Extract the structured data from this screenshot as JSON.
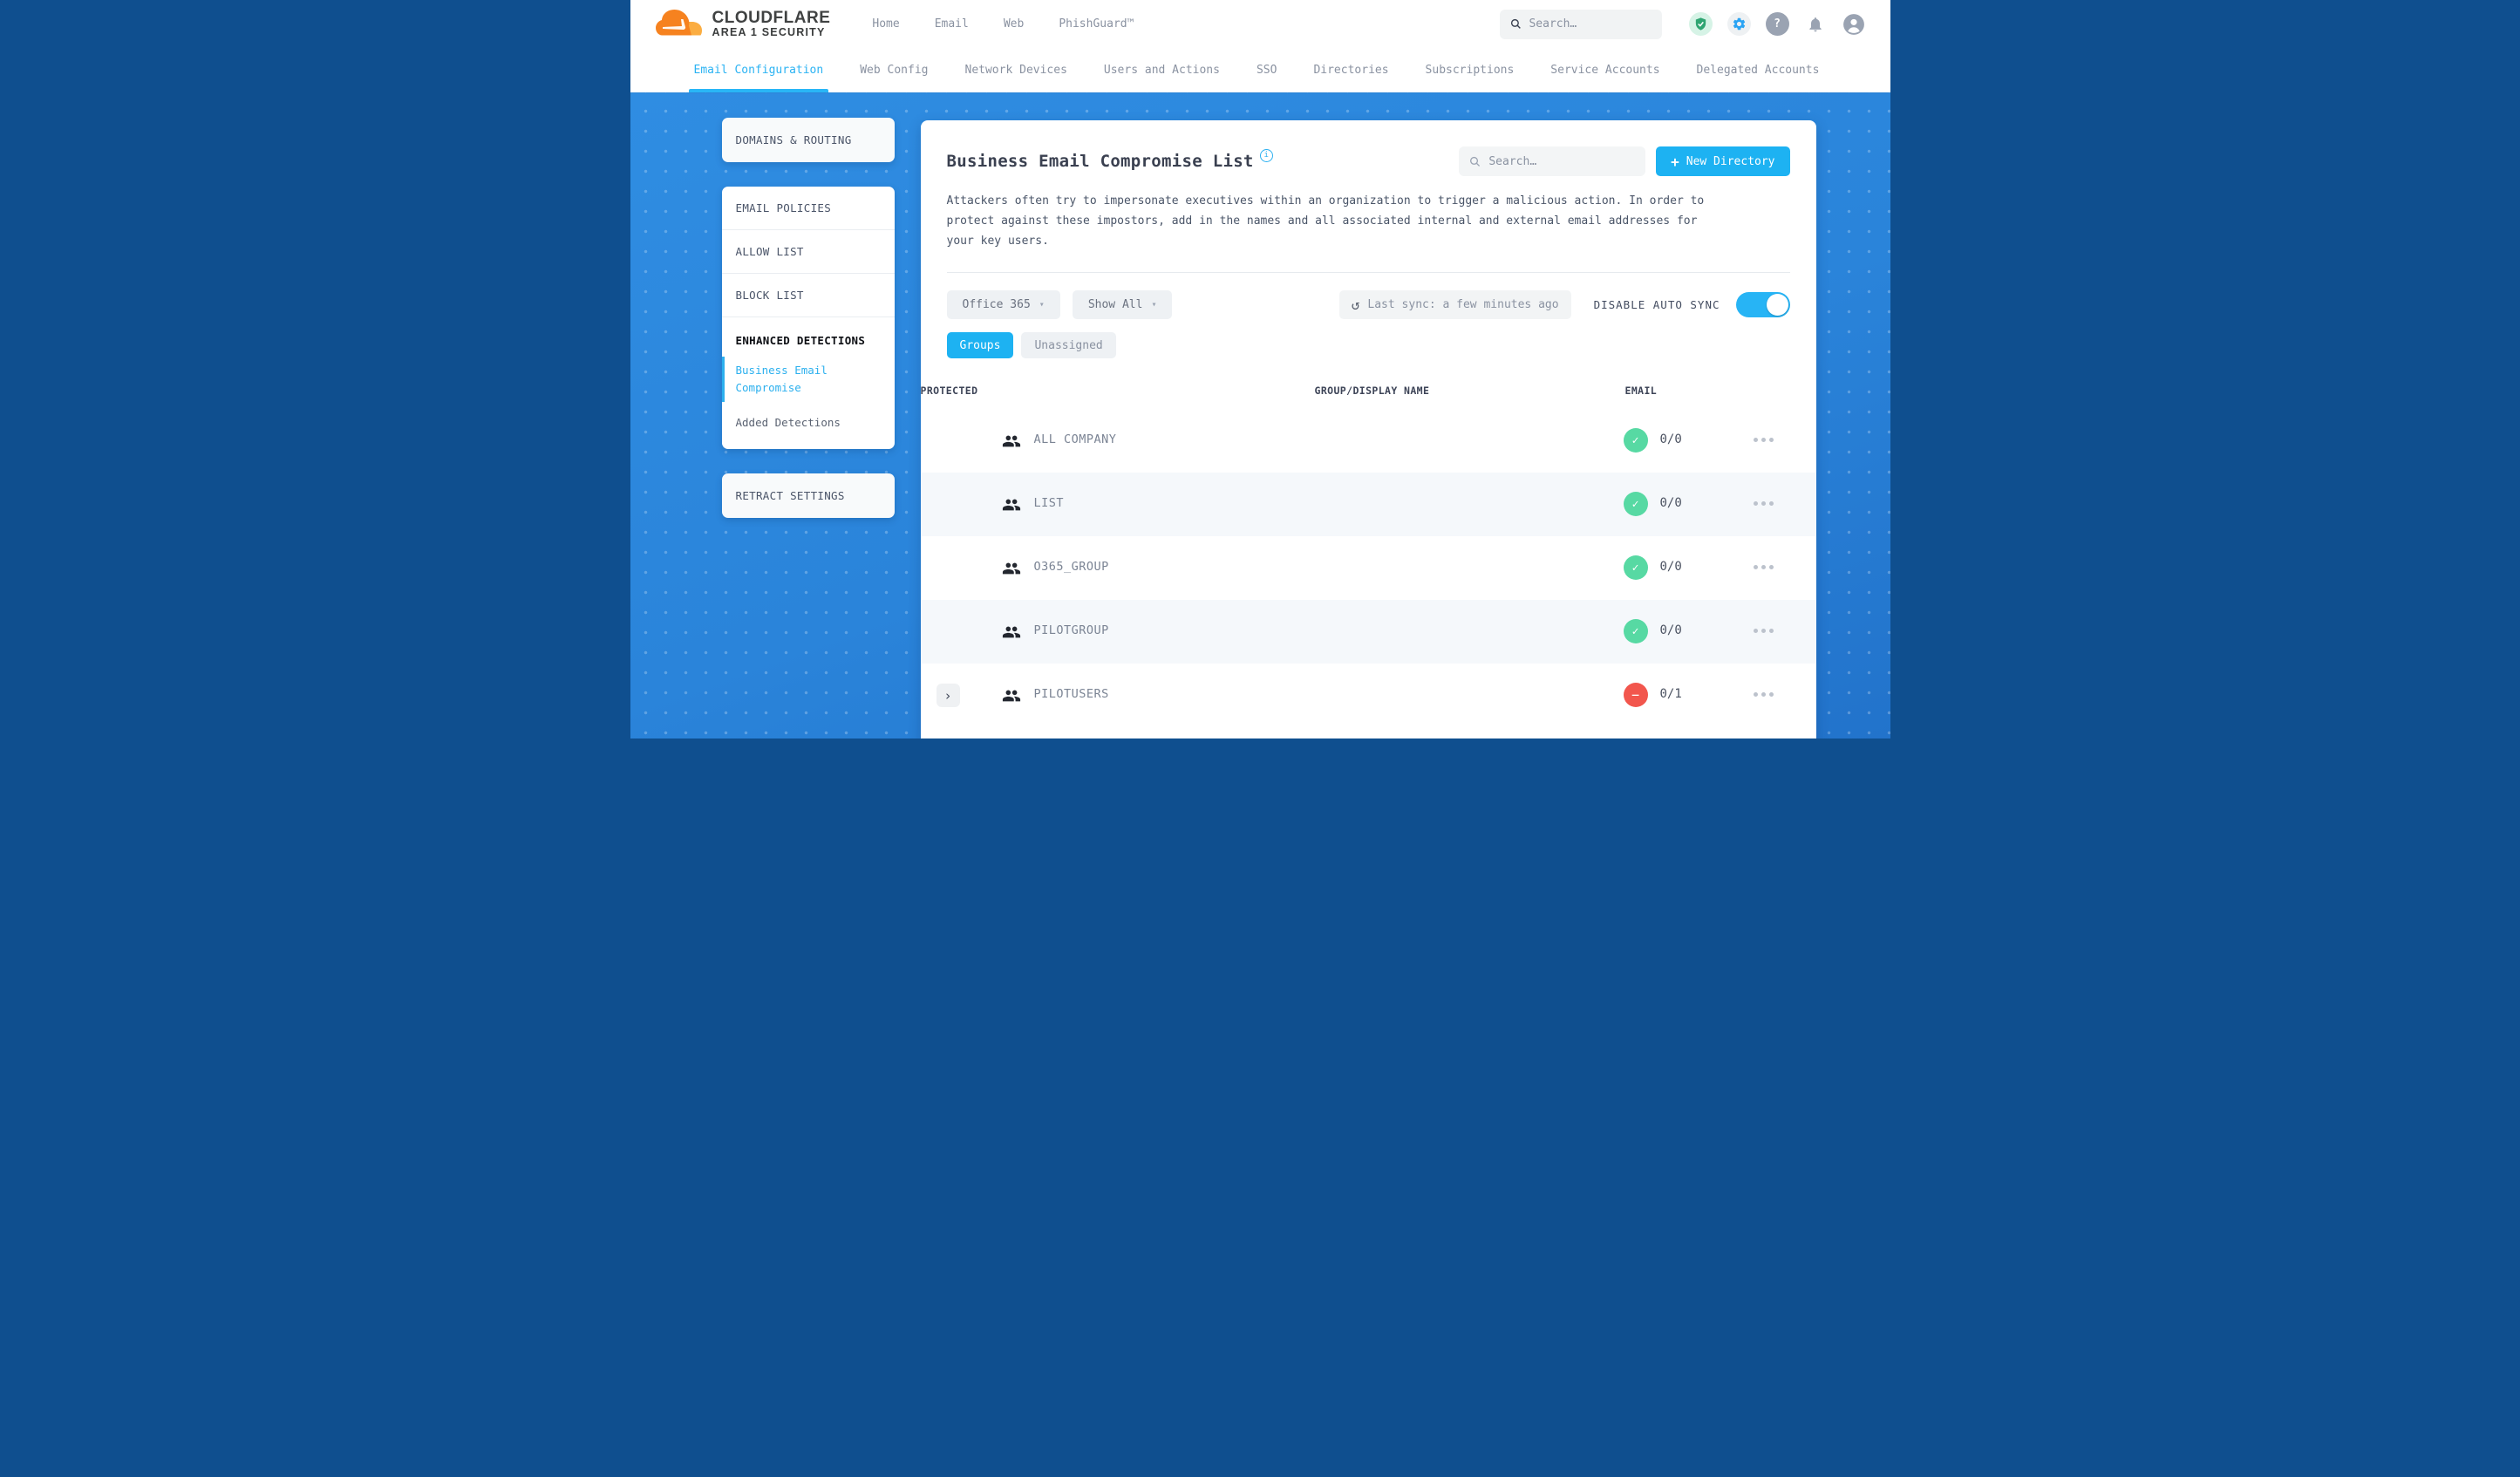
{
  "brand": {
    "name": "CLOUDFLARE",
    "tagline": "AREA 1 SECURITY"
  },
  "header": {
    "nav": [
      {
        "label": "Home"
      },
      {
        "label": "Email"
      },
      {
        "label": "Web"
      },
      {
        "label": "PhishGuard™"
      }
    ],
    "search_placeholder": "Search…"
  },
  "subnav": [
    {
      "label": "Email Configuration",
      "active": true
    },
    {
      "label": "Web Config"
    },
    {
      "label": "Network Devices"
    },
    {
      "label": "Users and Actions"
    },
    {
      "label": "SSO"
    },
    {
      "label": "Directories"
    },
    {
      "label": "Subscriptions"
    },
    {
      "label": "Service Accounts"
    },
    {
      "label": "Delegated Accounts"
    }
  ],
  "sidebar": {
    "domains_routing": "DOMAINS & ROUTING",
    "email_policies": "EMAIL POLICIES",
    "allow_list": "ALLOW LIST",
    "block_list": "BLOCK LIST",
    "enhanced_detections": "ENHANCED DETECTIONS",
    "business_email_compromise": "Business Email Compromise",
    "added_detections": "Added Detections",
    "retract_settings": "RETRACT SETTINGS"
  },
  "main": {
    "title": "Business Email Compromise List",
    "search_placeholder": "Search…",
    "new_directory": "New Directory",
    "description": "Attackers often try to impersonate executives within an organization to trigger a malicious action. In order to protect against these impostors, add in the names and all associated internal and external email addresses for your key users.",
    "filters": {
      "source": "Office 365",
      "show": "Show All",
      "last_sync": "Last sync: a few minutes ago",
      "auto_sync_label": "DISABLE AUTO SYNC",
      "auto_sync_on": true
    },
    "view_tabs": [
      {
        "label": "Groups",
        "active": true
      },
      {
        "label": "Unassigned"
      }
    ],
    "table": {
      "columns": [
        {
          "label": "GROUP/DISPLAY NAME"
        },
        {
          "label": "EMAIL"
        },
        {
          "label": "PROTECTED"
        }
      ],
      "rows": [
        {
          "name": "ALL COMPANY",
          "protected": "0/0",
          "status": "ok"
        },
        {
          "name": "LIST",
          "protected": "0/0",
          "status": "ok"
        },
        {
          "name": "O365_GROUP",
          "protected": "0/0",
          "status": "ok"
        },
        {
          "name": "PILOTGROUP",
          "protected": "0/0",
          "status": "ok"
        },
        {
          "name": "PILOTUSERS",
          "protected": "0/1",
          "status": "blocked",
          "expandable": true
        }
      ]
    }
  },
  "icons": {
    "plus": "+",
    "caret": "▾",
    "sync": "↺",
    "check": "✓",
    "minus": "−",
    "chevron": "›",
    "question": "?",
    "info": "i"
  },
  "colors": {
    "accent": "#1DB2F2",
    "blue_bg": "#2B86DC",
    "green": "#57D9A3",
    "red": "#F2564D"
  }
}
